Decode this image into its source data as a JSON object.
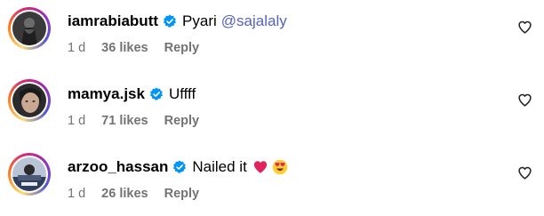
{
  "comments": [
    {
      "username": "iamrabiabutt",
      "text": "Pyari",
      "mention": "@sajalaly",
      "time": "1 d",
      "likes": "36 likes",
      "reply": "Reply"
    },
    {
      "username": "mamya.jsk",
      "text": "Uffff",
      "time": "1 d",
      "likes": "71 likes",
      "reply": "Reply"
    },
    {
      "username": "arzoo_hassan",
      "text": "Nailed it",
      "emojis": [
        "red-heart-emoji",
        "heart-eyes-emoji"
      ],
      "time": "1 d",
      "likes": "26 likes",
      "reply": "Reply"
    }
  ],
  "colors": {
    "verified": "#0095f6",
    "mention": "#5563c1",
    "meta": "#737373",
    "heart_emoji": "#e0245e"
  }
}
